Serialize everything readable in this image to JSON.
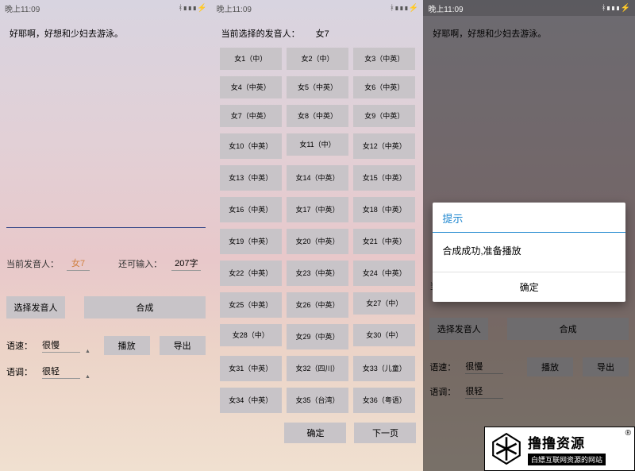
{
  "statusbar": {
    "time": "晚上11:09",
    "icons": "ᚼ▮▮▮⚡"
  },
  "panel1": {
    "text": "好耶啊，好想和少妇去游泳。",
    "speaker_label": "当前发音人：",
    "speaker_value": "女7",
    "remain_label": "还可输入：",
    "remain_value": "207字",
    "btn_select": "选择发音人",
    "btn_synth": "合成",
    "speed_label": "语速：",
    "speed_value": "很慢",
    "btn_play": "播放",
    "btn_export": "导出",
    "tone_label": "语调：",
    "tone_value": "很轻"
  },
  "panel2": {
    "header_label": "当前选择的发音人：",
    "header_value": "女7",
    "voices": [
      "女1（中）",
      "女2（中）",
      "女3（中英）",
      "女4（中英）",
      "女5（中英）",
      "女6（中英）",
      "女7（中英）",
      "女8（中英）",
      "女9（中英）",
      "女10（中英）",
      "女11（中）",
      "女12（中英）",
      "女13（中英）",
      "女14（中英）",
      "女15（中英）",
      "女16（中英）",
      "女17（中英）",
      "女18（中英）",
      "女19（中英）",
      "女20（中英）",
      "女21（中英）",
      "女22（中英）",
      "女23（中英）",
      "女24（中英）",
      "女25（中英）",
      "女26（中英）",
      "女27（中）",
      "女28（中）",
      "女29（中英）",
      "女30（中）",
      "女31（中英）",
      "女32（四川）",
      "女33（儿童）",
      "女34（中英）",
      "女35（台湾）",
      "女36（粤语）"
    ],
    "btn_confirm": "确定",
    "btn_next": "下一页"
  },
  "panel3": {
    "dialog_title": "提示",
    "dialog_body": "合成成功,准备播放",
    "dialog_ok": "确定"
  },
  "watermark": {
    "title": "撸撸资源",
    "subtitle": "白嫖互联网资源的网站",
    "reg": "®"
  }
}
